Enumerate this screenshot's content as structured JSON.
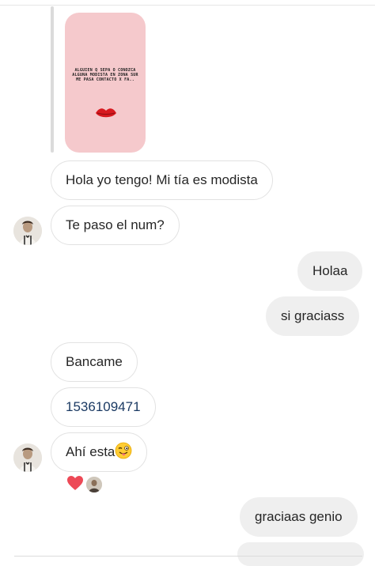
{
  "story": {
    "text": "ALGUIEN Q SEPA O CONOZCA\nALGUNA MODISTA EN ZONA SUR\nME PASA CONTACTO X FA.."
  },
  "messages": [
    {
      "id": "m1",
      "text": "Hola yo tengo! Mi tía es modista",
      "direction": "incoming"
    },
    {
      "id": "m2",
      "text": "Te paso el num?",
      "direction": "incoming"
    },
    {
      "id": "m3",
      "text": "Holaa",
      "direction": "outgoing"
    },
    {
      "id": "m4",
      "text": "si graciass",
      "direction": "outgoing"
    },
    {
      "id": "m5",
      "text": "Bancame",
      "direction": "incoming"
    },
    {
      "id": "m6",
      "text": "1536109471",
      "direction": "incoming"
    },
    {
      "id": "m7",
      "text": "Ahí esta",
      "direction": "incoming",
      "emoji": "winking-tongue-face-icon"
    },
    {
      "id": "m8",
      "text": "graciaas genio",
      "direction": "outgoing"
    }
  ],
  "reactions": {
    "emoji": "heart-icon",
    "color": "#ed4956"
  },
  "colors": {
    "incoming_bg": "#ffffff",
    "outgoing_bg": "#efefef",
    "border": "#e2e2e2",
    "link": "#1b3a63"
  }
}
